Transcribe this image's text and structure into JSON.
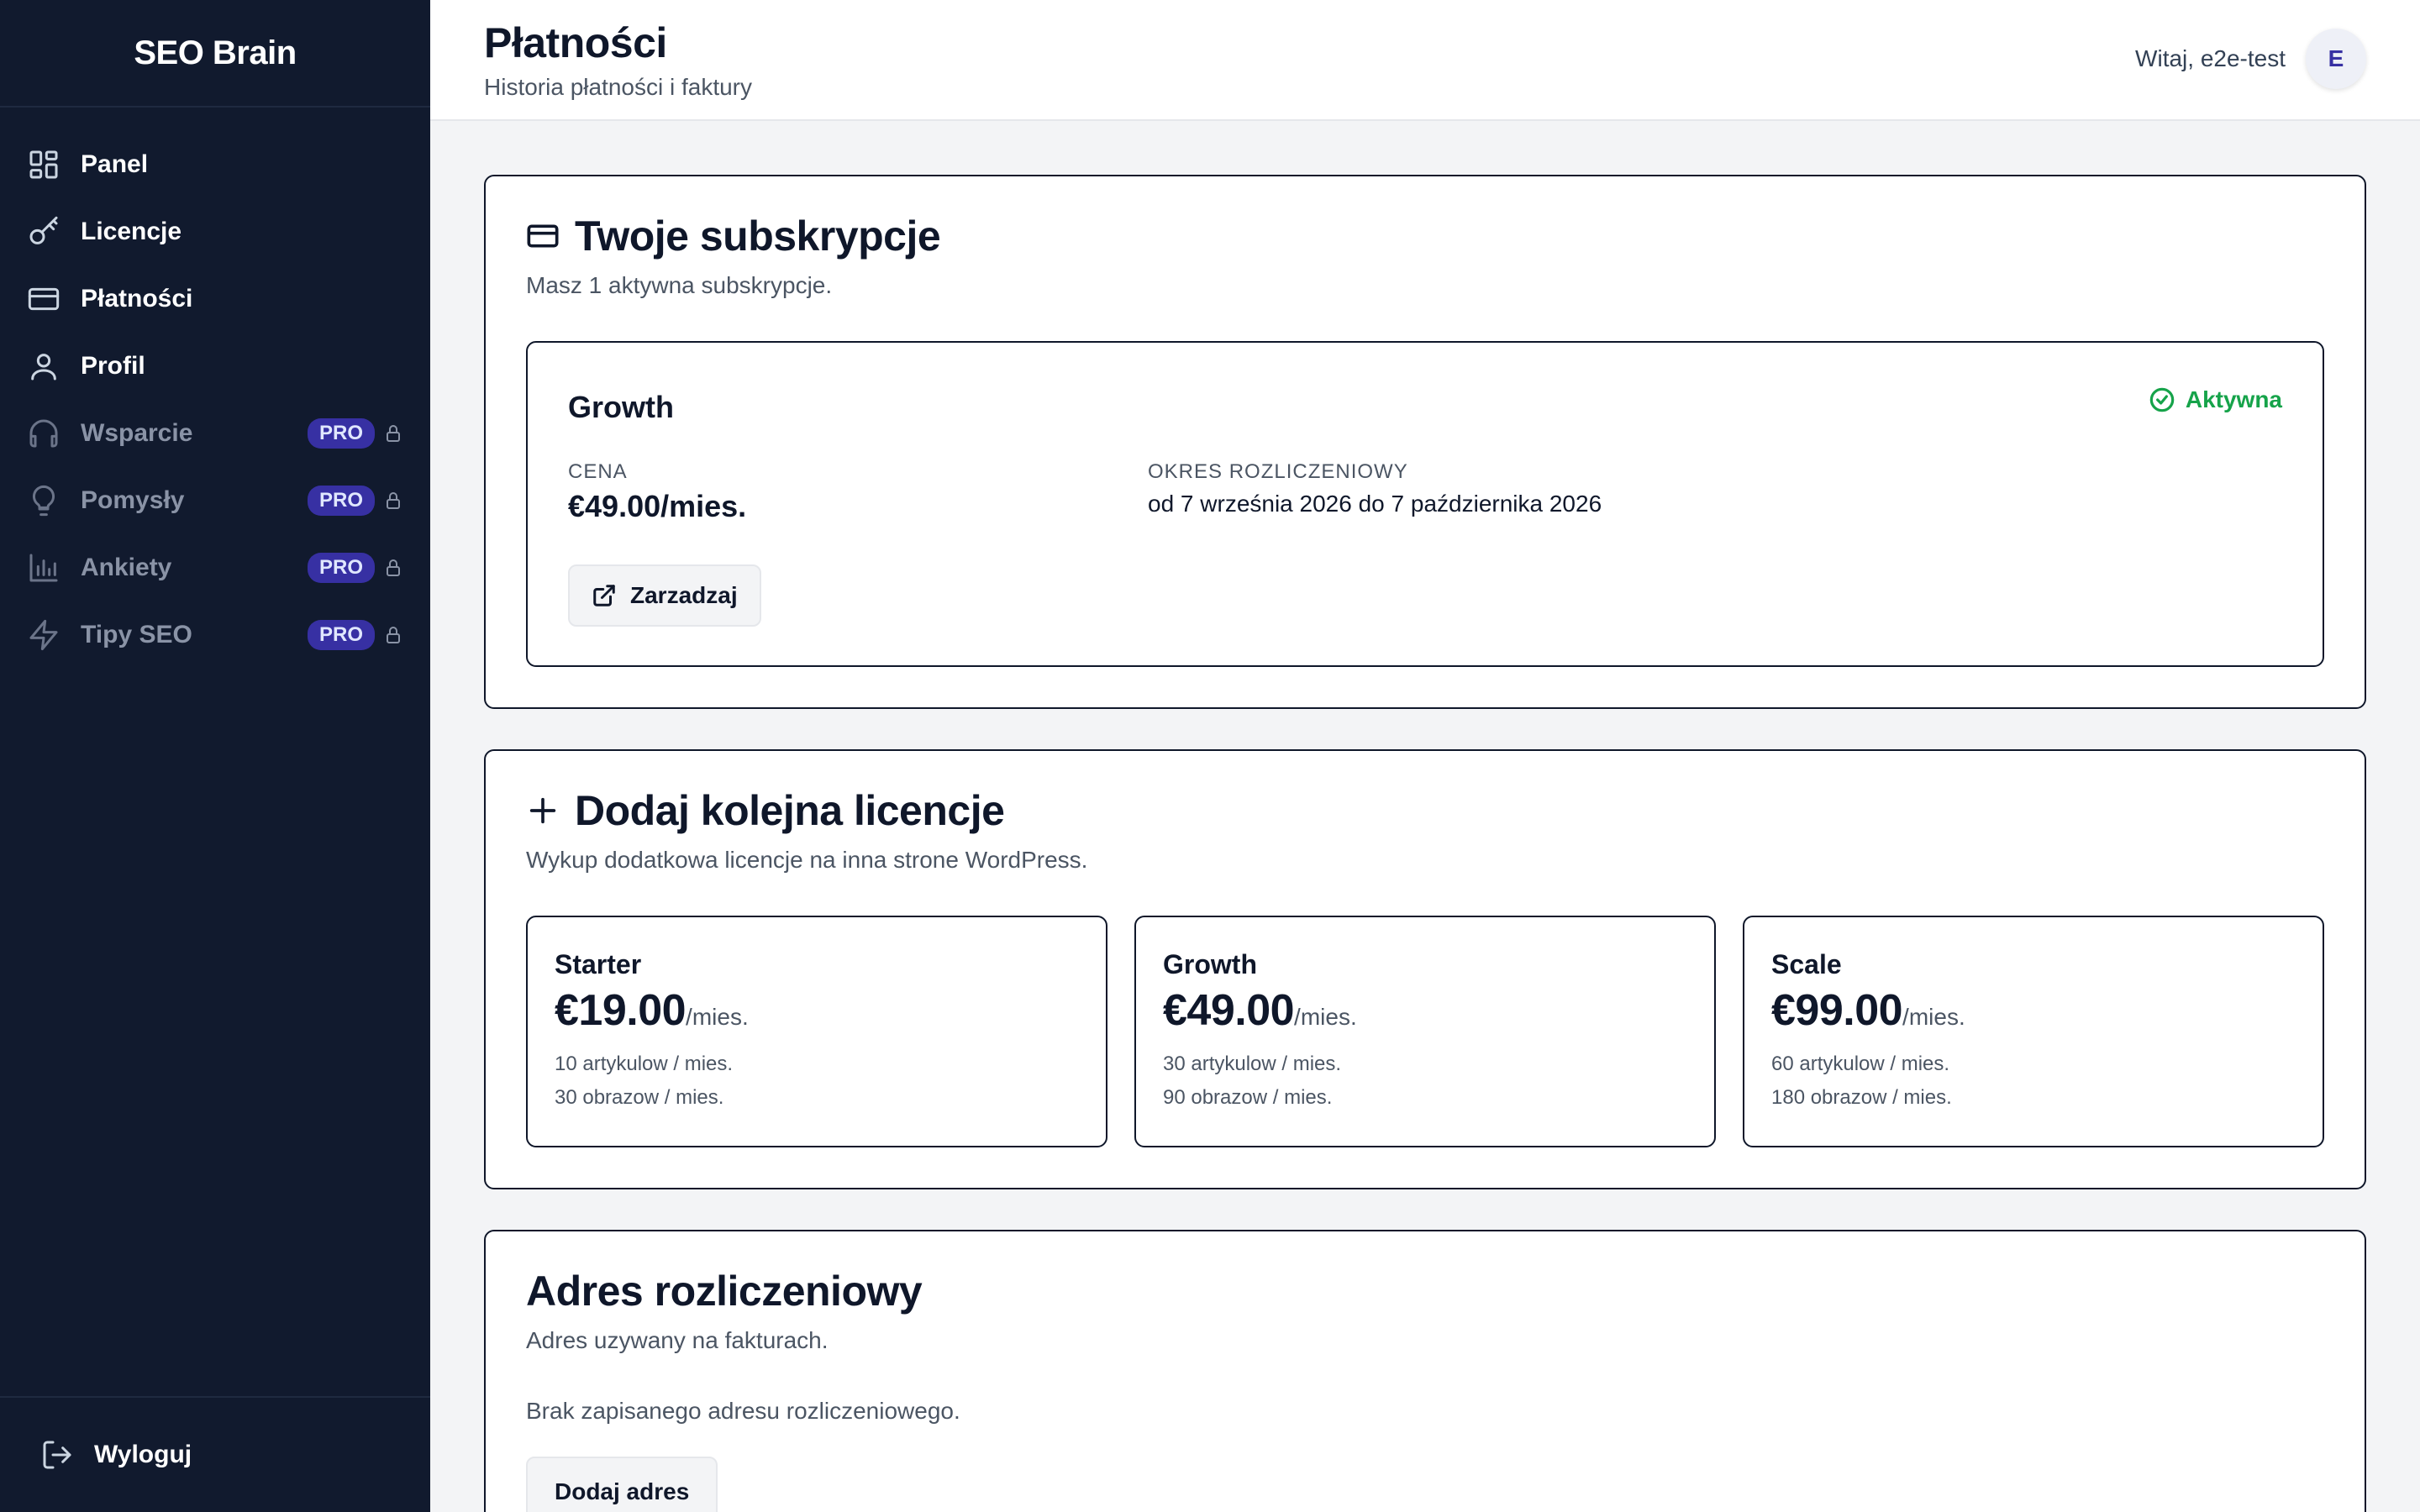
{
  "sidebar": {
    "brand": "SEO Brain",
    "items": [
      {
        "label": "Panel",
        "icon": "grid-icon",
        "pro": false
      },
      {
        "label": "Licencje",
        "icon": "key-icon",
        "pro": false
      },
      {
        "label": "Płatności",
        "icon": "credit-card-icon",
        "pro": false
      },
      {
        "label": "Profil",
        "icon": "user-icon",
        "pro": false
      },
      {
        "label": "Wsparcie",
        "icon": "headphones-icon",
        "pro": true,
        "badge": "PRO"
      },
      {
        "label": "Pomysły",
        "icon": "lightbulb-icon",
        "pro": true,
        "badge": "PRO"
      },
      {
        "label": "Ankiety",
        "icon": "bar-chart-icon",
        "pro": true,
        "badge": "PRO"
      },
      {
        "label": "Tipy SEO",
        "icon": "zap-icon",
        "pro": true,
        "badge": "PRO"
      }
    ],
    "logout": "Wyloguj"
  },
  "header": {
    "title": "Płatności",
    "subtitle": "Historia płatności i faktury",
    "greeting": "Witaj, e2e-test",
    "avatar_initial": "E"
  },
  "subscriptions": {
    "title": "Twoje subskrypcje",
    "description": "Masz 1 aktywna subskrypcje.",
    "plan": {
      "name": "Growth",
      "status": "Aktywna",
      "price_label": "Cena",
      "price": "€49.00/mies.",
      "period_label": "Okres rozliczeniowy",
      "period": "od 7 września 2026 do 7 października 2026",
      "manage_label": "Zarzadzaj"
    }
  },
  "add_license": {
    "title": "Dodaj kolejna licencje",
    "description": "Wykup dodatkowa licencje na inna strone WordPress.",
    "plans": [
      {
        "name": "Starter",
        "price": "€19.00",
        "per": "/mies.",
        "articles": "10 artykulow / mies.",
        "images": "30 obrazow / mies."
      },
      {
        "name": "Growth",
        "price": "€49.00",
        "per": "/mies.",
        "articles": "30 artykulow / mies.",
        "images": "90 obrazow / mies."
      },
      {
        "name": "Scale",
        "price": "€99.00",
        "per": "/mies.",
        "articles": "60 artykulow / mies.",
        "images": "180 obrazow / mies."
      }
    ]
  },
  "billing_address": {
    "title": "Adres rozliczeniowy",
    "description": "Adres uzywany na fakturach.",
    "empty_text": "Brak zapisanego adresu rozliczeniowego.",
    "add_label": "Dodaj adres"
  },
  "colors": {
    "sidebar_bg": "#111a2e",
    "pro_badge": "#3730a3",
    "active_status": "#16a34a"
  }
}
